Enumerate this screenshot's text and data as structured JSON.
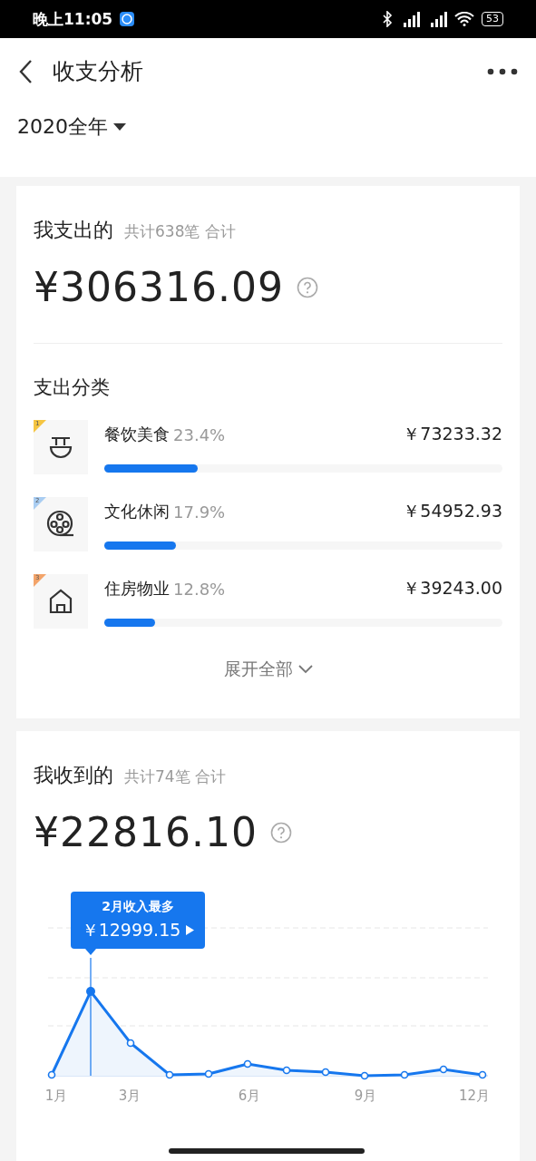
{
  "status_bar": {
    "time": "晚上11:05",
    "battery": "53"
  },
  "header": {
    "title": "收支分析"
  },
  "period": {
    "label": "2020全年"
  },
  "expense": {
    "title": "我支出的",
    "summary": "共计638笔 合计",
    "amount": "¥306316.09",
    "section_title": "支出分类",
    "categories": [
      {
        "kind": "food",
        "rank": "1",
        "color": "#f5c542",
        "name": "餐饮美食",
        "percent": "23.4%",
        "amount": "￥73233.32",
        "level": 0.234
      },
      {
        "kind": "film",
        "rank": "2",
        "color": "#a9cdf2",
        "name": "文化休闲",
        "percent": "17.9%",
        "amount": "￥54952.93",
        "level": 0.179
      },
      {
        "kind": "house",
        "rank": "3",
        "color": "#f3a46a",
        "name": "住房物业",
        "percent": "12.8%",
        "amount": "￥39243.00",
        "level": 0.128
      }
    ],
    "expand": "展开全部"
  },
  "income": {
    "title": "我收到的",
    "summary": "共计74笔 合计",
    "amount": "¥22816.10",
    "tooltip": {
      "title": "2月收入最多",
      "amount": "￥12999.15"
    },
    "months": [
      "1月",
      "3月",
      "6月",
      "9月",
      "12月"
    ]
  }
}
